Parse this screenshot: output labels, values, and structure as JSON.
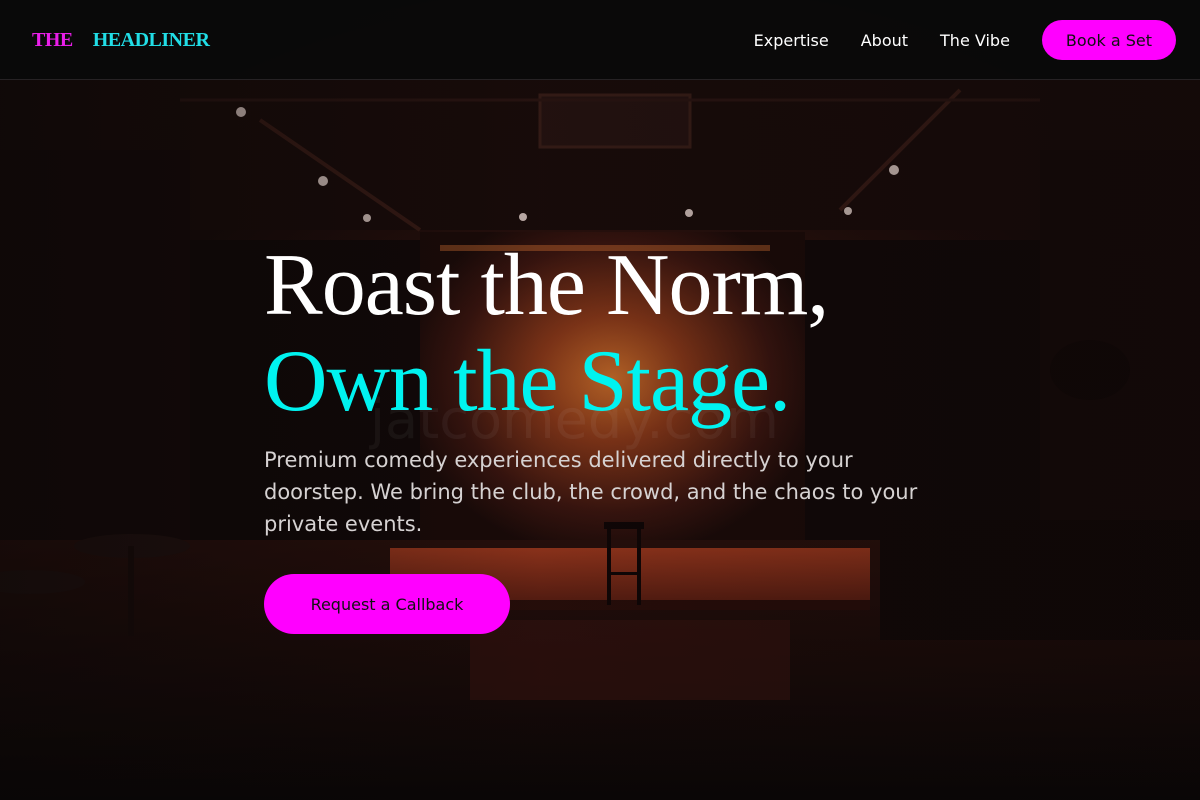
{
  "colors": {
    "accent_magenta": "#ff00ff",
    "accent_cyan": "#00f3f0",
    "header_bg": "#0a0a0a",
    "stage_glow": "#e07a2a"
  },
  "header": {
    "logo_part1": "THE",
    "logo_part2": "HEADLINER",
    "nav": {
      "expertise": "Expertise",
      "about": "About",
      "vibe": "The Vibe"
    },
    "cta_label": "Book a Set"
  },
  "hero": {
    "headline_line1": "Roast the Norm,",
    "headline_line2": "Own the Stage.",
    "subtext": "Premium comedy experiences delivered directly to your doorstep. We bring the club, the crowd, and the chaos to your private events.",
    "cta_label": "Request a Callback"
  },
  "background": {
    "image": "dim comedy club stage with orange backlight, bar stool and ceiling spotlights"
  }
}
